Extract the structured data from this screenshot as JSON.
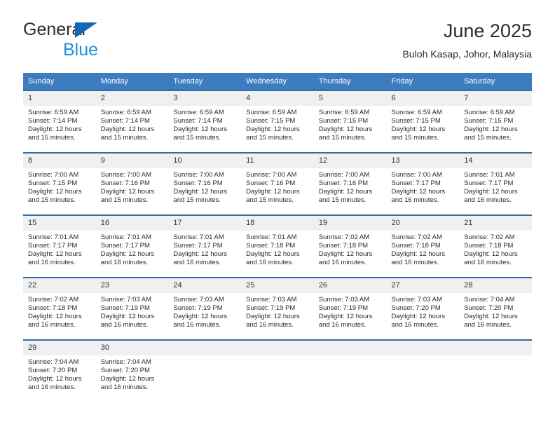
{
  "brand": {
    "name_top": "General",
    "name_bottom": "Blue",
    "triangle_color": "#1268b3",
    "blue_text_color": "#1f8fe0"
  },
  "header": {
    "title": "June 2025",
    "location": "Buloh Kasap, Johor, Malaysia"
  },
  "colors": {
    "header_row_bg": "#3d7cbf",
    "header_row_text": "#ffffff",
    "cell_top_border": "#2e6da8",
    "daynum_bg": "#f0f0f0",
    "cell_bg": "#ffffff"
  },
  "weekdays": [
    "Sunday",
    "Monday",
    "Tuesday",
    "Wednesday",
    "Thursday",
    "Friday",
    "Saturday"
  ],
  "weeks": [
    [
      {
        "day": "1",
        "sunrise": "Sunrise: 6:59 AM",
        "sunset": "Sunset: 7:14 PM",
        "daylight": "Daylight: 12 hours and 15 minutes."
      },
      {
        "day": "2",
        "sunrise": "Sunrise: 6:59 AM",
        "sunset": "Sunset: 7:14 PM",
        "daylight": "Daylight: 12 hours and 15 minutes."
      },
      {
        "day": "3",
        "sunrise": "Sunrise: 6:59 AM",
        "sunset": "Sunset: 7:14 PM",
        "daylight": "Daylight: 12 hours and 15 minutes."
      },
      {
        "day": "4",
        "sunrise": "Sunrise: 6:59 AM",
        "sunset": "Sunset: 7:15 PM",
        "daylight": "Daylight: 12 hours and 15 minutes."
      },
      {
        "day": "5",
        "sunrise": "Sunrise: 6:59 AM",
        "sunset": "Sunset: 7:15 PM",
        "daylight": "Daylight: 12 hours and 15 minutes."
      },
      {
        "day": "6",
        "sunrise": "Sunrise: 6:59 AM",
        "sunset": "Sunset: 7:15 PM",
        "daylight": "Daylight: 12 hours and 15 minutes."
      },
      {
        "day": "7",
        "sunrise": "Sunrise: 6:59 AM",
        "sunset": "Sunset: 7:15 PM",
        "daylight": "Daylight: 12 hours and 15 minutes."
      }
    ],
    [
      {
        "day": "8",
        "sunrise": "Sunrise: 7:00 AM",
        "sunset": "Sunset: 7:15 PM",
        "daylight": "Daylight: 12 hours and 15 minutes."
      },
      {
        "day": "9",
        "sunrise": "Sunrise: 7:00 AM",
        "sunset": "Sunset: 7:16 PM",
        "daylight": "Daylight: 12 hours and 15 minutes."
      },
      {
        "day": "10",
        "sunrise": "Sunrise: 7:00 AM",
        "sunset": "Sunset: 7:16 PM",
        "daylight": "Daylight: 12 hours and 15 minutes."
      },
      {
        "day": "11",
        "sunrise": "Sunrise: 7:00 AM",
        "sunset": "Sunset: 7:16 PM",
        "daylight": "Daylight: 12 hours and 15 minutes."
      },
      {
        "day": "12",
        "sunrise": "Sunrise: 7:00 AM",
        "sunset": "Sunset: 7:16 PM",
        "daylight": "Daylight: 12 hours and 15 minutes."
      },
      {
        "day": "13",
        "sunrise": "Sunrise: 7:00 AM",
        "sunset": "Sunset: 7:17 PM",
        "daylight": "Daylight: 12 hours and 16 minutes."
      },
      {
        "day": "14",
        "sunrise": "Sunrise: 7:01 AM",
        "sunset": "Sunset: 7:17 PM",
        "daylight": "Daylight: 12 hours and 16 minutes."
      }
    ],
    [
      {
        "day": "15",
        "sunrise": "Sunrise: 7:01 AM",
        "sunset": "Sunset: 7:17 PM",
        "daylight": "Daylight: 12 hours and 16 minutes."
      },
      {
        "day": "16",
        "sunrise": "Sunrise: 7:01 AM",
        "sunset": "Sunset: 7:17 PM",
        "daylight": "Daylight: 12 hours and 16 minutes."
      },
      {
        "day": "17",
        "sunrise": "Sunrise: 7:01 AM",
        "sunset": "Sunset: 7:17 PM",
        "daylight": "Daylight: 12 hours and 16 minutes."
      },
      {
        "day": "18",
        "sunrise": "Sunrise: 7:01 AM",
        "sunset": "Sunset: 7:18 PM",
        "daylight": "Daylight: 12 hours and 16 minutes."
      },
      {
        "day": "19",
        "sunrise": "Sunrise: 7:02 AM",
        "sunset": "Sunset: 7:18 PM",
        "daylight": "Daylight: 12 hours and 16 minutes."
      },
      {
        "day": "20",
        "sunrise": "Sunrise: 7:02 AM",
        "sunset": "Sunset: 7:18 PM",
        "daylight": "Daylight: 12 hours and 16 minutes."
      },
      {
        "day": "21",
        "sunrise": "Sunrise: 7:02 AM",
        "sunset": "Sunset: 7:18 PM",
        "daylight": "Daylight: 12 hours and 16 minutes."
      }
    ],
    [
      {
        "day": "22",
        "sunrise": "Sunrise: 7:02 AM",
        "sunset": "Sunset: 7:18 PM",
        "daylight": "Daylight: 12 hours and 16 minutes."
      },
      {
        "day": "23",
        "sunrise": "Sunrise: 7:03 AM",
        "sunset": "Sunset: 7:19 PM",
        "daylight": "Daylight: 12 hours and 16 minutes."
      },
      {
        "day": "24",
        "sunrise": "Sunrise: 7:03 AM",
        "sunset": "Sunset: 7:19 PM",
        "daylight": "Daylight: 12 hours and 16 minutes."
      },
      {
        "day": "25",
        "sunrise": "Sunrise: 7:03 AM",
        "sunset": "Sunset: 7:19 PM",
        "daylight": "Daylight: 12 hours and 16 minutes."
      },
      {
        "day": "26",
        "sunrise": "Sunrise: 7:03 AM",
        "sunset": "Sunset: 7:19 PM",
        "daylight": "Daylight: 12 hours and 16 minutes."
      },
      {
        "day": "27",
        "sunrise": "Sunrise: 7:03 AM",
        "sunset": "Sunset: 7:20 PM",
        "daylight": "Daylight: 12 hours and 16 minutes."
      },
      {
        "day": "28",
        "sunrise": "Sunrise: 7:04 AM",
        "sunset": "Sunset: 7:20 PM",
        "daylight": "Daylight: 12 hours and 16 minutes."
      }
    ],
    [
      {
        "day": "29",
        "sunrise": "Sunrise: 7:04 AM",
        "sunset": "Sunset: 7:20 PM",
        "daylight": "Daylight: 12 hours and 16 minutes."
      },
      {
        "day": "30",
        "sunrise": "Sunrise: 7:04 AM",
        "sunset": "Sunset: 7:20 PM",
        "daylight": "Daylight: 12 hours and 16 minutes."
      },
      {
        "day": "",
        "sunrise": "",
        "sunset": "",
        "daylight": ""
      },
      {
        "day": "",
        "sunrise": "",
        "sunset": "",
        "daylight": ""
      },
      {
        "day": "",
        "sunrise": "",
        "sunset": "",
        "daylight": ""
      },
      {
        "day": "",
        "sunrise": "",
        "sunset": "",
        "daylight": ""
      },
      {
        "day": "",
        "sunrise": "",
        "sunset": "",
        "daylight": ""
      }
    ]
  ]
}
